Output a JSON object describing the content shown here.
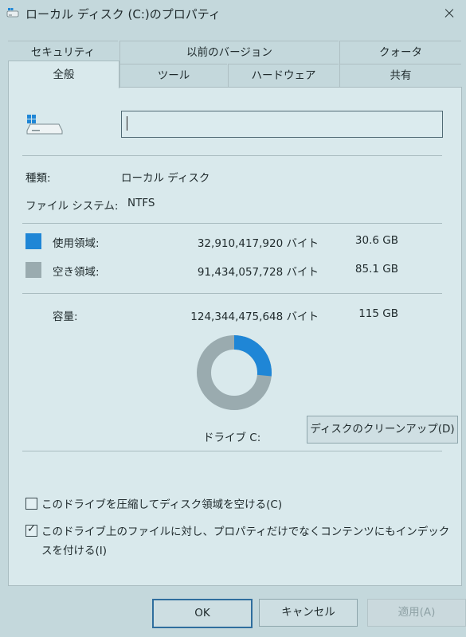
{
  "window": {
    "title": "ローカル ディスク (C:)のプロパティ",
    "icon": "drive-icon",
    "close_icon": "close-icon"
  },
  "tabs": {
    "row1": [
      "セキュリティ",
      "以前のバージョン",
      "クォータ"
    ],
    "row2": [
      "全般",
      "ツール",
      "ハードウェア",
      "共有"
    ],
    "active": "全般"
  },
  "general": {
    "name_value": "",
    "type_label": "種類:",
    "type_value": "ローカル ディスク",
    "fs_label": "ファイル システム:",
    "fs_value": "NTFS",
    "used": {
      "label": "使用領域:",
      "bytes": "32,910,417,920 バイト",
      "size": "30.6 GB",
      "color": "#1f86d6"
    },
    "free": {
      "label": "空き領域:",
      "bytes": "91,434,057,728 バイト",
      "size": "85.1 GB",
      "color": "#9aabaf"
    },
    "capacity": {
      "label": "容量:",
      "bytes": "124,344,475,648 バイト",
      "size": "115 GB"
    },
    "used_fraction": 0.265,
    "drive_label": "ドライブ C:",
    "cleanup_button": "ディスクのクリーンアップ(D)",
    "compress_option": {
      "label": "このドライブを圧縮してディスク領域を空ける(C)",
      "checked": false
    },
    "index_option": {
      "label_line1": "このドライブ上のファイルに対し、プロパティだけでなくコンテンツにもインデック",
      "label_line2": "スを付ける(I)",
      "checked": true
    }
  },
  "buttons": {
    "ok": "OK",
    "cancel": "キャンセル",
    "apply": "適用(A)",
    "apply_enabled": false
  }
}
